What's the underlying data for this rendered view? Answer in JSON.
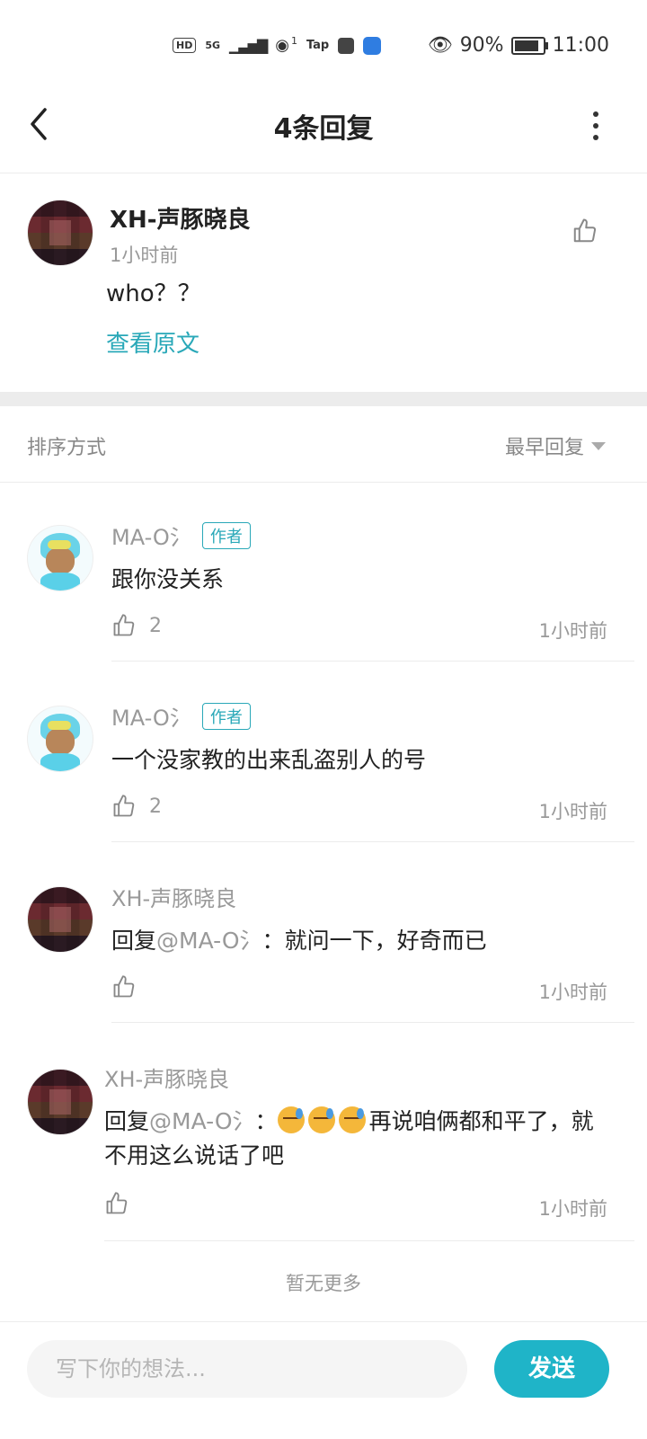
{
  "status_bar": {
    "network": "HD",
    "signal": "5G",
    "hotspot_count": "1",
    "app_label": "Tap",
    "battery": "90%",
    "time": "11:00"
  },
  "header": {
    "title": "4条回复"
  },
  "main_comment": {
    "author": "XH-声豚晓良",
    "time": "1小时前",
    "text": "who？？",
    "view_original": "查看原文"
  },
  "sort": {
    "label": "排序方式",
    "selected": "最早回复"
  },
  "replies": [
    {
      "author": "MA-O氵",
      "tag": "作者",
      "text": "跟你没关系",
      "likes": "2",
      "time": "1小时前"
    },
    {
      "author": "MA-O氵",
      "tag": "作者",
      "text": "一个没家教的出来乱盗别人的号",
      "likes": "2",
      "time": "1小时前"
    },
    {
      "author": "XH-声豚晓良",
      "prefix": "回复",
      "mention": "@MA-O氵",
      "colon": "：",
      "text": "就问一下，好奇而已",
      "time": "1小时前"
    },
    {
      "author": "XH-声豚晓良",
      "prefix": "回复",
      "mention": "@MA-O氵",
      "colon": "：",
      "text": "再说咱俩都和平了，就不用这么说话了吧",
      "time": "1小时前"
    }
  ],
  "footer_note": "暂无更多",
  "composer": {
    "placeholder": "写下你的想法...",
    "send_label": "发送"
  },
  "colors": {
    "accent": "#1fb4c8",
    "link": "#29a8b8"
  },
  "icons": [
    "back-icon",
    "more-icon",
    "like-icon",
    "dropdown-icon",
    "sweat-emoji-icon"
  ]
}
